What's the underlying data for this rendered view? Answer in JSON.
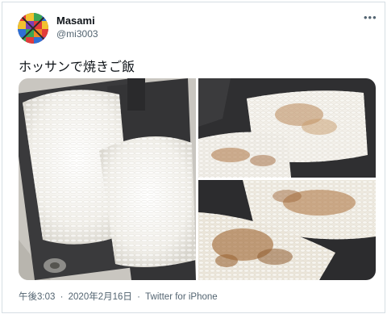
{
  "user": {
    "name": "Masami",
    "handle": "@mi3003"
  },
  "more_icon": "more-horizontal-icon",
  "tweet": {
    "text": "ホッサンで焼きご飯"
  },
  "media": [
    {
      "name": "rice-in-hotsand-maker-photo"
    },
    {
      "name": "grilled-rice-photo-1"
    },
    {
      "name": "grilled-rice-photo-2"
    }
  ],
  "meta": {
    "time": "午後3:03",
    "separator": "·",
    "date": "2020年2月16日",
    "source": "Twitter for iPhone"
  },
  "colors": {
    "text": "#0f1419",
    "secondary": "#536471",
    "border": "#d6dee4"
  }
}
